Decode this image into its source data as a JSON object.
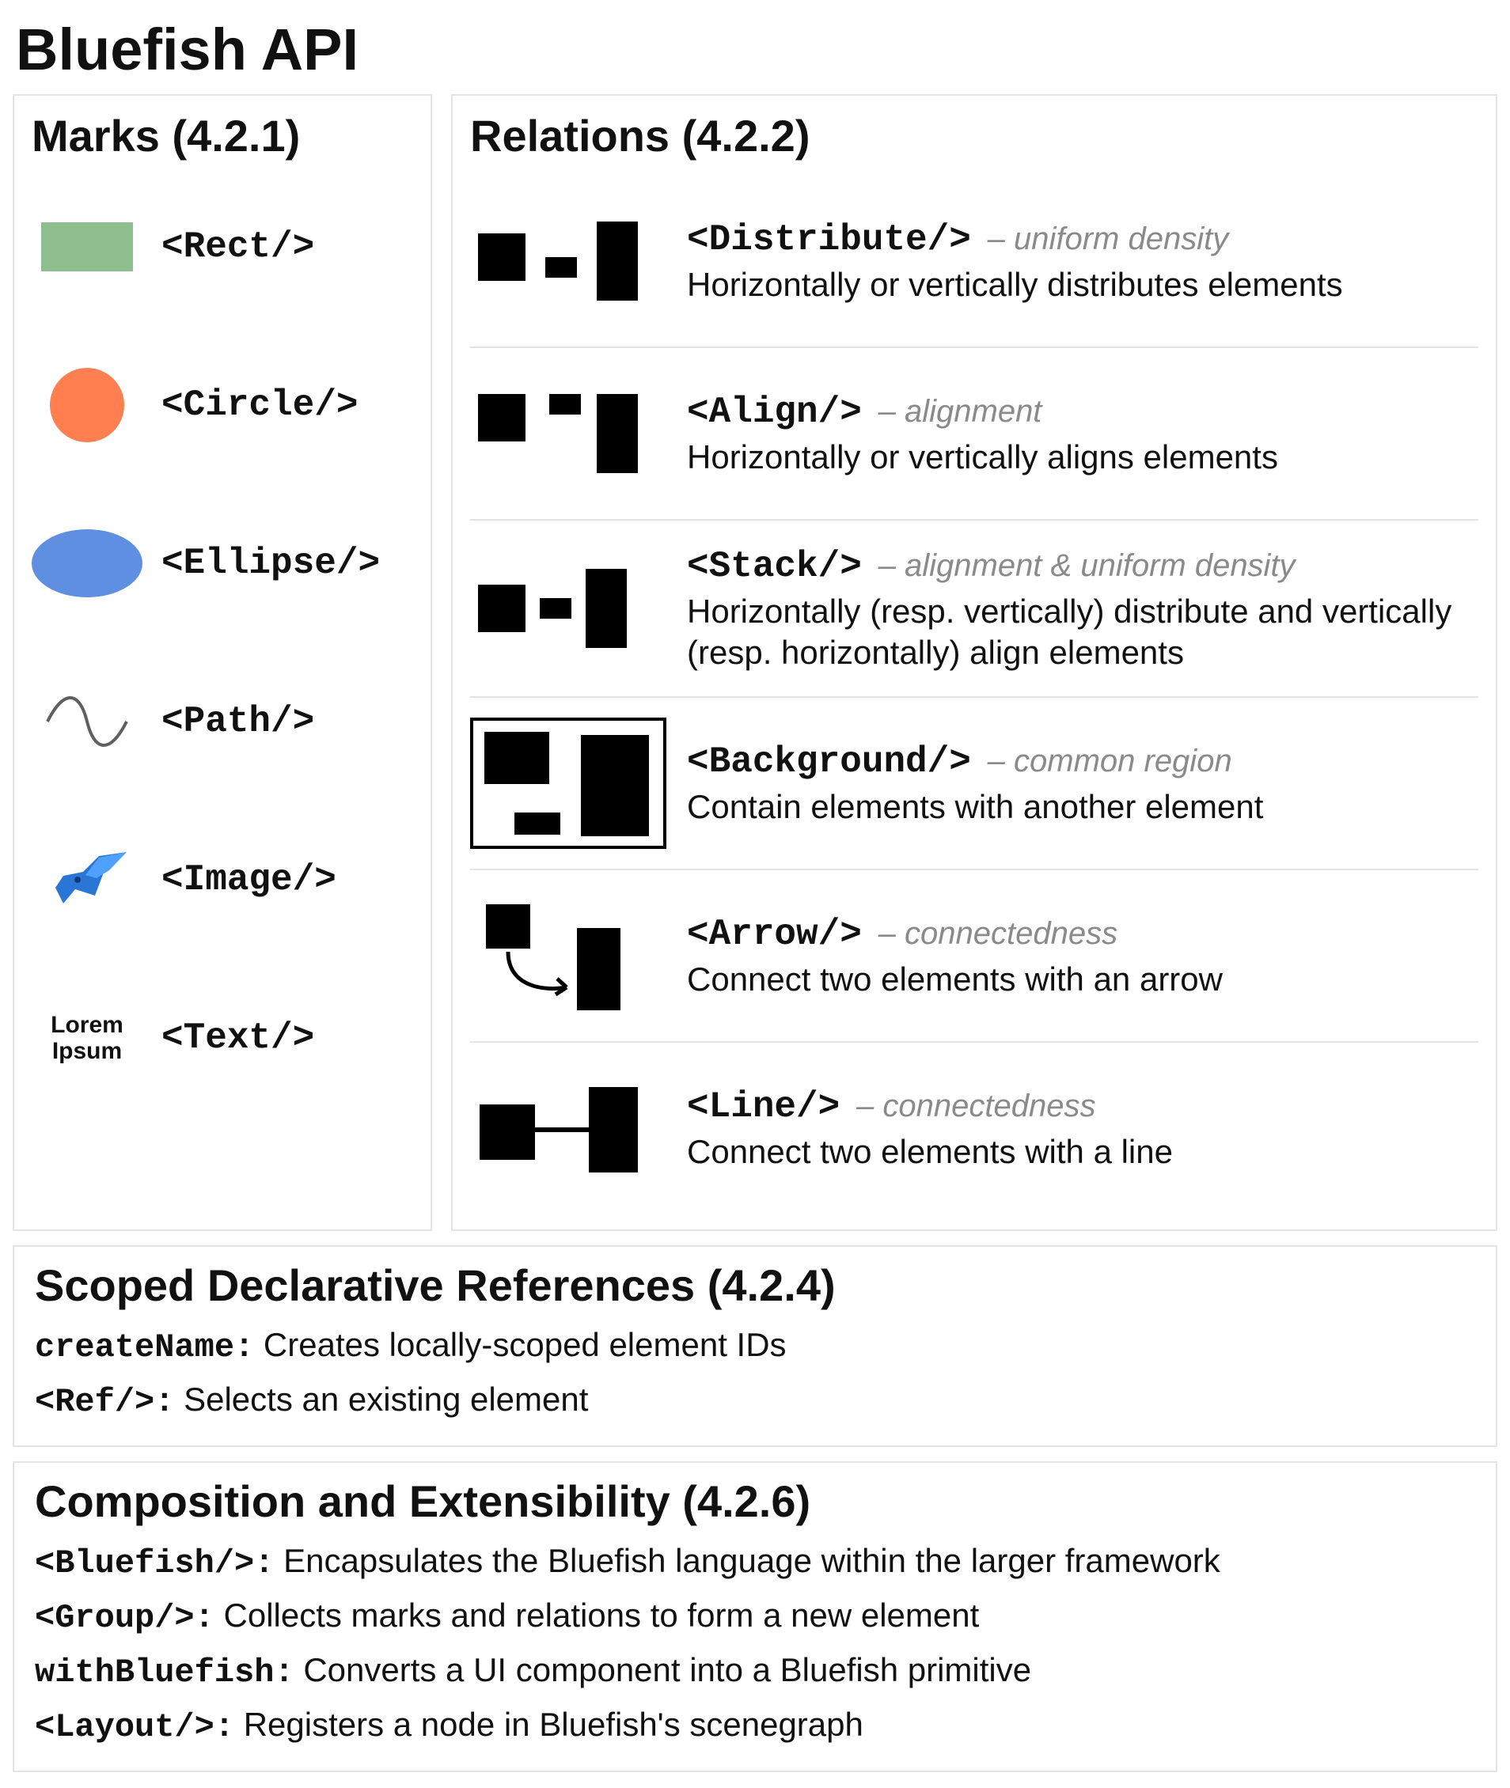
{
  "pageTitle": "Bluefish API",
  "marks": {
    "title": "Marks (4.2.1)",
    "items": [
      {
        "tag": "<Rect/>"
      },
      {
        "tag": "<Circle/>"
      },
      {
        "tag": "<Ellipse/>"
      },
      {
        "tag": "<Path/>"
      },
      {
        "tag": "<Image/>"
      },
      {
        "tag": "<Text/>",
        "sampleLine1": "Lorem",
        "sampleLine2": "Ipsum"
      }
    ]
  },
  "relations": {
    "title": "Relations (4.2.2)",
    "items": [
      {
        "tag": "<Distribute/>",
        "note": "– uniform density",
        "desc": "Horizontally or vertically distributes elements"
      },
      {
        "tag": "<Align/>",
        "note": "– alignment",
        "desc": "Horizontally or vertically aligns elements"
      },
      {
        "tag": "<Stack/>",
        "note": "– alignment & uniform density",
        "desc": "Horizontally (resp. vertically) distribute and vertically (resp. horizontally) align elements"
      },
      {
        "tag": "<Background/>",
        "note": "– common region",
        "desc": "Contain elements with another element"
      },
      {
        "tag": "<Arrow/>",
        "note": "– connectedness",
        "desc": "Connect two elements with an arrow"
      },
      {
        "tag": "<Line/>",
        "note": "– connectedness",
        "desc": "Connect two elements with a line"
      }
    ]
  },
  "scoped": {
    "title": "Scoped Declarative References (4.2.4)",
    "items": [
      {
        "term": "createName:",
        "desc": " Creates locally-scoped element IDs"
      },
      {
        "term": "<Ref/>:",
        "desc": " Selects an existing element"
      }
    ]
  },
  "comp": {
    "title": "Composition and Extensibility (4.2.6)",
    "items": [
      {
        "term": "<Bluefish/>:",
        "desc": " Encapsulates the Bluefish language within the larger framework"
      },
      {
        "term": "<Group/>:",
        "desc": " Collects marks and relations to form a new element"
      },
      {
        "term": "withBluefish:",
        "desc": " Converts a UI component into a Bluefish primitive"
      },
      {
        "term": "<Layout/>:",
        "desc": " Registers a node in Bluefish's scenegraph"
      }
    ]
  }
}
